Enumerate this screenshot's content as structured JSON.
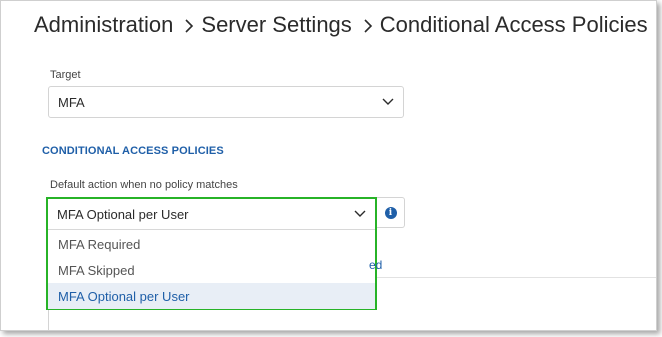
{
  "breadcrumb": {
    "items": [
      "Administration",
      "Server Settings",
      "Conditional Access Policies"
    ]
  },
  "target": {
    "label": "Target",
    "value": "MFA"
  },
  "policies_section": {
    "title": "CONDITIONAL ACCESS POLICIES",
    "default_action_label": "Default action when no policy matches",
    "default_action_value": "MFA Optional per User",
    "options": [
      "MFA Required",
      "MFA Skipped",
      "MFA Optional per User"
    ],
    "selected_option": "MFA Optional per User"
  },
  "partial_tab_text": "ed",
  "icons": {
    "chevron": "chevron-down-icon",
    "separator": "chevron-right-icon",
    "info": "info-icon"
  },
  "colors": {
    "accent": "#1f5fa8",
    "highlight_border": "#27b327",
    "selected_bg": "#e8eef6"
  }
}
